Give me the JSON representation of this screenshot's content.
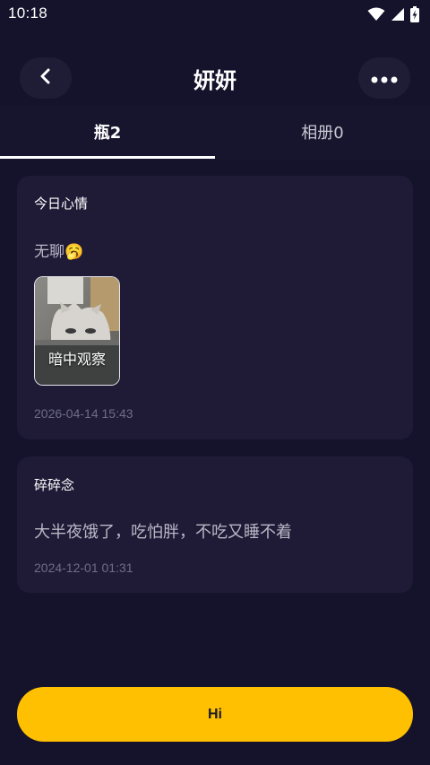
{
  "status_bar": {
    "time": "10:18"
  },
  "header": {
    "title": "妍妍"
  },
  "tabs": [
    {
      "label": "瓶2",
      "active": true
    },
    {
      "label": "相册0",
      "active": false
    }
  ],
  "posts": [
    {
      "title": "今日心情",
      "text": "无聊🥱",
      "image_caption": "暗中观察",
      "timestamp": "2026-04-14 15:43"
    },
    {
      "title": "碎碎念",
      "text": "大半夜饿了，吃怕胖，不吃又睡不着",
      "timestamp": "2024-12-01 01:31"
    }
  ],
  "actions": {
    "hi_label": "Hi"
  },
  "colors": {
    "background": "#15122b",
    "card": "#1f1b37",
    "accent": "#fec000"
  }
}
